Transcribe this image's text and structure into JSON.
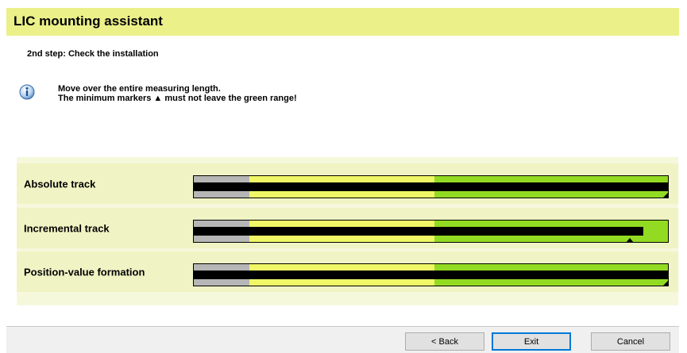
{
  "header": {
    "title": "LIC mounting assistant",
    "bg_color": "#ebf089"
  },
  "step": {
    "label": "2nd step: Check the installation"
  },
  "info": {
    "icon": "info-icon",
    "line1": "Move over the entire measuring length.",
    "line2": "The minimum markers ▲ must not leave the green range!"
  },
  "colors": {
    "gray_range": "#b6b6b6",
    "yellow_range": "#eff767",
    "green_range": "#93db22",
    "row_bg": "#f0f4c4",
    "panel_bg": "#f6f8dc"
  },
  "tracks": [
    {
      "label": "Absolute track",
      "level_fraction": 1.0,
      "min_marker_fraction": 1.0
    },
    {
      "label": "Incremental track",
      "level_fraction": 0.948,
      "min_marker_fraction": 0.92
    },
    {
      "label": "Position-value formation",
      "level_fraction": 1.0,
      "min_marker_fraction": 1.0
    }
  ],
  "buttons": {
    "back": "< Back",
    "exit": "Exit",
    "cancel": "Cancel"
  }
}
